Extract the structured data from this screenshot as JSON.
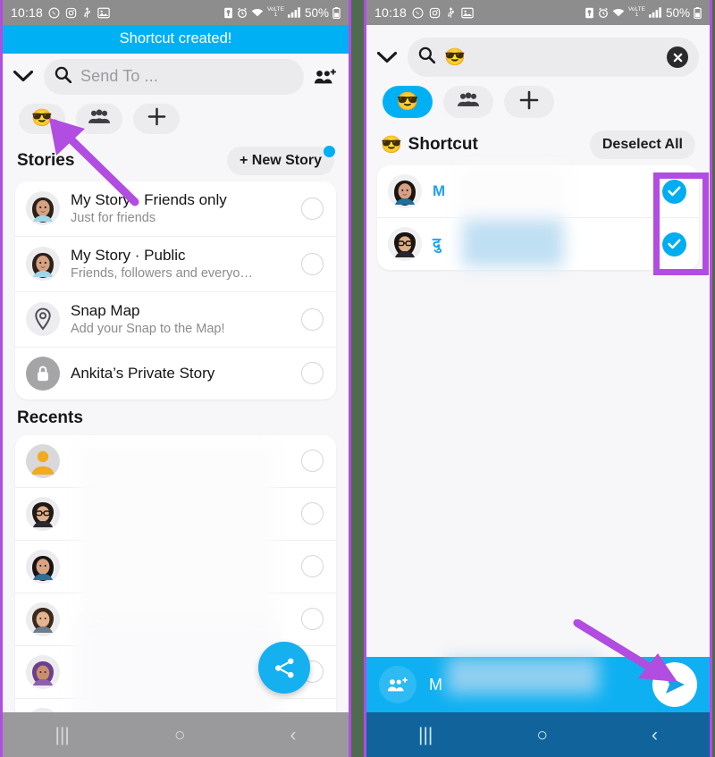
{
  "status_bar": {
    "time": "10:18",
    "left_icons": [
      "whatsapp-icon",
      "instagram-icon",
      "usb-icon",
      "screenshot-icon"
    ],
    "right_icons": [
      "sim-icon",
      "alarm-icon",
      "wifi-icon",
      "volte-icon",
      "signal-icon"
    ],
    "battery_percent": "50%"
  },
  "left_panel": {
    "toast": "Shortcut created!",
    "search": {
      "placeholder": "Send To ...",
      "search_icon": "search-icon",
      "chevron_icon": "chevron-down-icon",
      "group_icon": "add-group-icon"
    },
    "chips": [
      {
        "label": "😎",
        "name": "shortcut-emoji-chip",
        "active": false
      },
      {
        "label": "group-icon",
        "name": "groups-chip",
        "active": false
      },
      {
        "label": "+",
        "name": "add-chip",
        "active": false
      }
    ],
    "stories": {
      "section_title": "Stories",
      "new_story_button": "+ New Story",
      "items": [
        {
          "title": "My Story · Friends only",
          "subtitle": "Just for friends",
          "avatar": "bitmoji-female",
          "selected": false
        },
        {
          "title": "My Story · Public",
          "subtitle": "Friends, followers and everyo…",
          "avatar": "bitmoji-female",
          "selected": false
        },
        {
          "title": "Snap Map",
          "subtitle": "Add your Snap to the Map!",
          "avatar": "map-pin-icon",
          "selected": false
        },
        {
          "title": "Ankita’s Private Story",
          "subtitle": "",
          "avatar": "lock-icon",
          "selected": false
        }
      ]
    },
    "recents": {
      "section_title": "Recents",
      "items": [
        {
          "title": "",
          "subtitle": "",
          "avatar": "contact-yellow",
          "selected": false,
          "blurred": true
        },
        {
          "title": "",
          "subtitle": "",
          "avatar": "bitmoji-glasses",
          "selected": false,
          "blurred": true
        },
        {
          "title": "",
          "subtitle": "",
          "avatar": "bitmoji-female",
          "selected": false,
          "blurred": true
        },
        {
          "title": "",
          "subtitle": "",
          "avatar": "bitmoji-male",
          "selected": false,
          "blurred": true
        },
        {
          "title": "",
          "subtitle": "",
          "avatar": "bitmoji-purple",
          "selected": false,
          "blurred": true
        },
        {
          "title": "",
          "subtitle": "",
          "avatar": "bitmoji-curly",
          "selected": false,
          "blurred": true
        }
      ]
    },
    "share_fab": "share-icon"
  },
  "right_panel": {
    "search": {
      "value": "😎",
      "placeholder": "",
      "search_icon": "search-icon",
      "chevron_icon": "chevron-down-icon",
      "clear_icon": "clear-icon"
    },
    "chips": [
      {
        "label": "😎",
        "name": "shortcut-emoji-chip",
        "active": true
      },
      {
        "label": "group-icon",
        "name": "groups-chip",
        "active": false
      },
      {
        "label": "+",
        "name": "add-chip",
        "active": false
      }
    ],
    "shortcut": {
      "emoji": "😎",
      "section_title": "Shortcut",
      "deselect_all": "Deselect All",
      "items": [
        {
          "title": "M",
          "avatar": "bitmoji-female",
          "selected": true,
          "blurred": true
        },
        {
          "title": "दु",
          "avatar": "bitmoji-glasses",
          "selected": true,
          "blurred": true
        }
      ]
    },
    "send_bar": {
      "group_icon": "add-group-icon",
      "recipients": "M",
      "send_icon": "send-icon"
    }
  },
  "android_nav": {
    "recents_icon": "|||",
    "home_icon": "○",
    "back_icon": "‹"
  },
  "annotations": {
    "highlight_color": "#b14de0",
    "arrow_color": "#b14de0",
    "arrows": [
      {
        "name": "arrow-to-shortcut-chip",
        "panel": "left"
      },
      {
        "name": "arrow-to-send-button",
        "panel": "right"
      }
    ],
    "boxes": [
      {
        "name": "highlight-selected-checkmarks",
        "panel": "right"
      }
    ]
  },
  "colors": {
    "snapchat_blue": "#00b0f4",
    "toast_blue": "#00b0f4",
    "highlight_purple": "#b14de0",
    "gap_green": "#4e6b4e"
  }
}
